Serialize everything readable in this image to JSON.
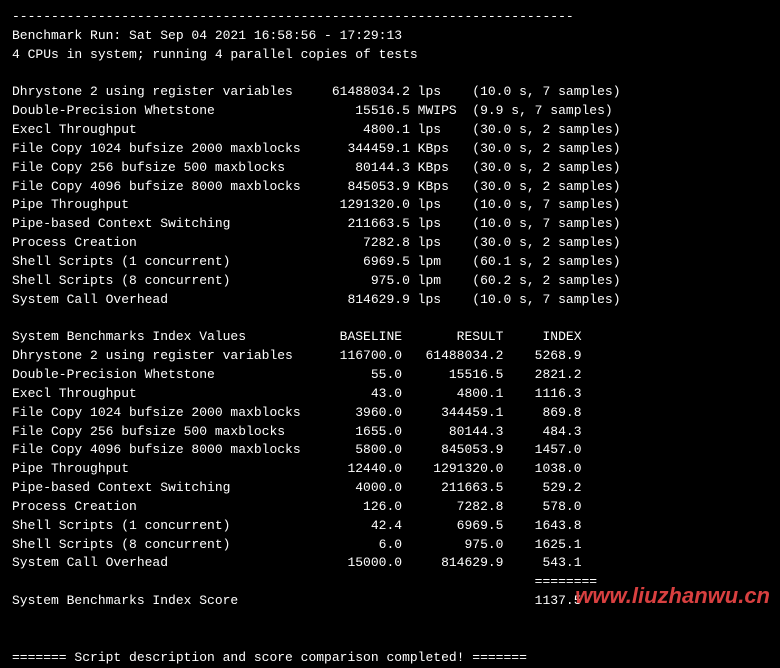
{
  "divider": "------------------------------------------------------------------------",
  "header": {
    "run_line": "Benchmark Run: Sat Sep 04 2021 16:58:56 - 17:29:13",
    "cpu_line": "4 CPUs in system; running 4 parallel copies of tests"
  },
  "results": [
    {
      "name": "Dhrystone 2 using register variables",
      "value": "61488034.2",
      "unit": "lps",
      "timing": "(10.0 s, 7 samples)"
    },
    {
      "name": "Double-Precision Whetstone",
      "value": "15516.5",
      "unit": "MWIPS",
      "timing": "(9.9 s, 7 samples)"
    },
    {
      "name": "Execl Throughput",
      "value": "4800.1",
      "unit": "lps",
      "timing": "(30.0 s, 2 samples)"
    },
    {
      "name": "File Copy 1024 bufsize 2000 maxblocks",
      "value": "344459.1",
      "unit": "KBps",
      "timing": "(30.0 s, 2 samples)"
    },
    {
      "name": "File Copy 256 bufsize 500 maxblocks",
      "value": "80144.3",
      "unit": "KBps",
      "timing": "(30.0 s, 2 samples)"
    },
    {
      "name": "File Copy 4096 bufsize 8000 maxblocks",
      "value": "845053.9",
      "unit": "KBps",
      "timing": "(30.0 s, 2 samples)"
    },
    {
      "name": "Pipe Throughput",
      "value": "1291320.0",
      "unit": "lps",
      "timing": "(10.0 s, 7 samples)"
    },
    {
      "name": "Pipe-based Context Switching",
      "value": "211663.5",
      "unit": "lps",
      "timing": "(10.0 s, 7 samples)"
    },
    {
      "name": "Process Creation",
      "value": "7282.8",
      "unit": "lps",
      "timing": "(30.0 s, 2 samples)"
    },
    {
      "name": "Shell Scripts (1 concurrent)",
      "value": "6969.5",
      "unit": "lpm",
      "timing": "(60.1 s, 2 samples)"
    },
    {
      "name": "Shell Scripts (8 concurrent)",
      "value": "975.0",
      "unit": "lpm",
      "timing": "(60.2 s, 2 samples)"
    },
    {
      "name": "System Call Overhead",
      "value": "814629.9",
      "unit": "lps",
      "timing": "(10.0 s, 7 samples)"
    }
  ],
  "index_header": {
    "title": "System Benchmarks Index Values",
    "col1": "BASELINE",
    "col2": "RESULT",
    "col3": "INDEX"
  },
  "index_rows": [
    {
      "name": "Dhrystone 2 using register variables",
      "baseline": "116700.0",
      "result": "61488034.2",
      "index": "5268.9"
    },
    {
      "name": "Double-Precision Whetstone",
      "baseline": "55.0",
      "result": "15516.5",
      "index": "2821.2"
    },
    {
      "name": "Execl Throughput",
      "baseline": "43.0",
      "result": "4800.1",
      "index": "1116.3"
    },
    {
      "name": "File Copy 1024 bufsize 2000 maxblocks",
      "baseline": "3960.0",
      "result": "344459.1",
      "index": "869.8"
    },
    {
      "name": "File Copy 256 bufsize 500 maxblocks",
      "baseline": "1655.0",
      "result": "80144.3",
      "index": "484.3"
    },
    {
      "name": "File Copy 4096 bufsize 8000 maxblocks",
      "baseline": "5800.0",
      "result": "845053.9",
      "index": "1457.0"
    },
    {
      "name": "Pipe Throughput",
      "baseline": "12440.0",
      "result": "1291320.0",
      "index": "1038.0"
    },
    {
      "name": "Pipe-based Context Switching",
      "baseline": "4000.0",
      "result": "211663.5",
      "index": "529.2"
    },
    {
      "name": "Process Creation",
      "baseline": "126.0",
      "result": "7282.8",
      "index": "578.0"
    },
    {
      "name": "Shell Scripts (1 concurrent)",
      "baseline": "42.4",
      "result": "6969.5",
      "index": "1643.8"
    },
    {
      "name": "Shell Scripts (8 concurrent)",
      "baseline": "6.0",
      "result": "975.0",
      "index": "1625.1"
    },
    {
      "name": "System Call Overhead",
      "baseline": "15000.0",
      "result": "814629.9",
      "index": "543.1"
    }
  ],
  "eq_line": "                                                                   ========",
  "score": {
    "label": "System Benchmarks Index Score",
    "value": "1137.5"
  },
  "footer": "======= Script description and score comparison completed! =======",
  "watermark": "www.liuzhanwu.cn"
}
